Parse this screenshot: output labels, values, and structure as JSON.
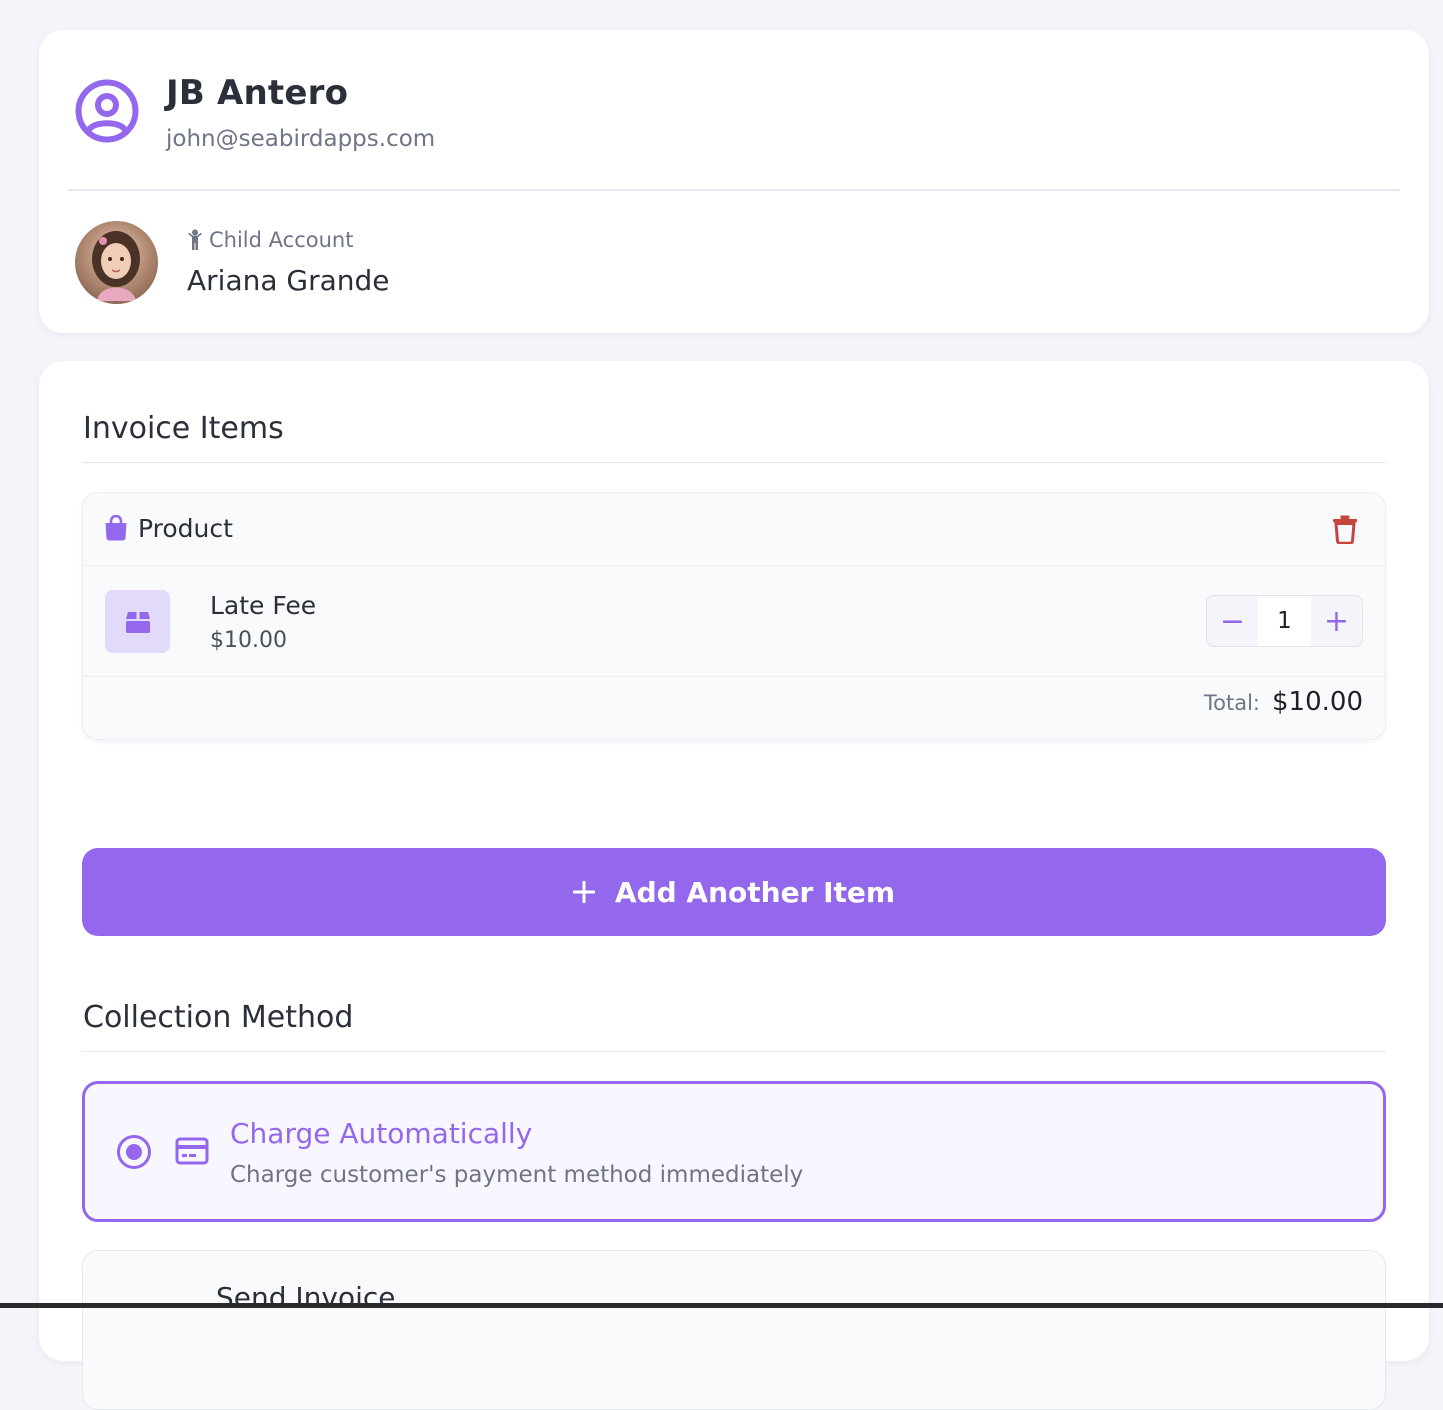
{
  "customer": {
    "name": "JB Antero",
    "email": "john@seabirdapps.com",
    "child": {
      "tag": "Child Account",
      "name": "Ariana Grande"
    }
  },
  "invoice": {
    "items_title": "Invoice Items",
    "items": [
      {
        "type": "Product",
        "name": "Late Fee",
        "price": "$10.00",
        "quantity": "1",
        "decrement_label": "−",
        "increment_label": "+",
        "total_label": "Total:",
        "total_value": "$10.00"
      }
    ],
    "add_button_label": "Add Another Item",
    "collection_title": "Collection Method",
    "methods": [
      {
        "title": "Charge Automatically",
        "description": "Charge customer's payment method immediately",
        "selected": true
      },
      {
        "title": "Send Invoice",
        "selected": false
      }
    ]
  },
  "colors": {
    "accent": "#9468ec",
    "danger": "#c6453d",
    "background": "#f4f5fa"
  },
  "icons": {
    "user": "user-circle-icon",
    "child": "child-icon",
    "product": "shopping-bag-icon",
    "delete": "trash-icon",
    "thumbnail": "box-icon",
    "add": "plus-icon",
    "payment": "credit-card-icon"
  }
}
